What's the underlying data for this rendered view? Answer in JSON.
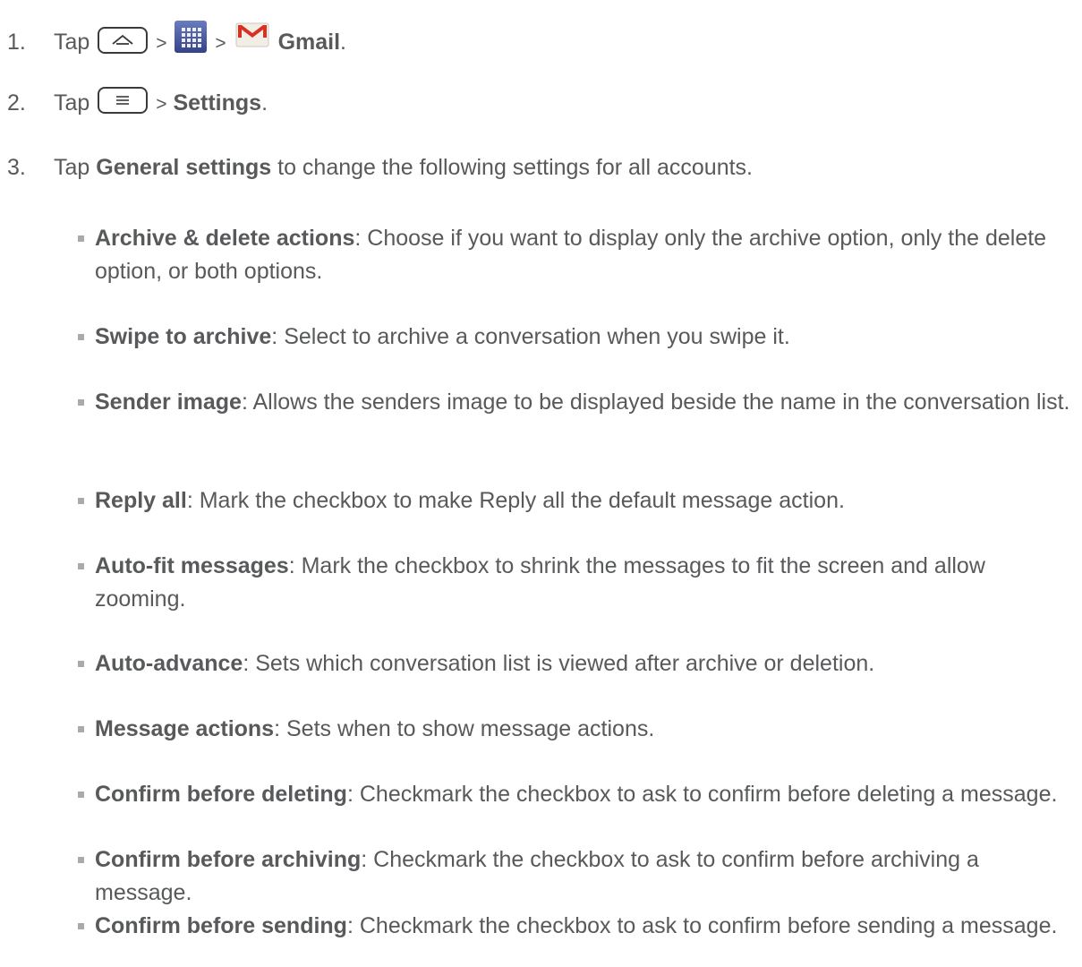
{
  "steps": [
    {
      "num": "1.",
      "pre": "Tap",
      "sep1": ">",
      "sep2": ">",
      "bold": "Gmail",
      "post": "."
    },
    {
      "num": "2.",
      "pre": "Tap",
      "sep1": ">",
      "bold": "Settings",
      "post": "."
    },
    {
      "num": "3.",
      "pre": "Tap ",
      "bold": "General settings",
      "post": " to change the following settings for all accounts."
    }
  ],
  "icons": {
    "home_key": "home-key-icon",
    "apps": "apps-grid-icon",
    "gmail": "gmail-envelope-icon",
    "menu_key": "menu-key-icon"
  },
  "bullets": [
    {
      "term": "Archive & delete actions",
      "desc": ": Choose if you want to display only the archive option, only the delete option, or both options."
    },
    {
      "term": "Swipe to archive",
      "desc": ": Select to archive a conversation when you swipe it."
    },
    {
      "term": "Sender image",
      "desc": ": Allows the senders image to be displayed beside the name in the conversation list."
    },
    {
      "term": "Reply all",
      "desc": ": Mark the checkbox to make Reply all the default message action."
    },
    {
      "term": "Auto-fit messages",
      "desc": ": Mark the checkbox to shrink the messages to fit the screen and allow zooming."
    },
    {
      "term": "Auto-advance",
      "desc": ": Sets which conversation list is viewed after archive or deletion."
    },
    {
      "term": "Message actions",
      "desc": ": Sets when to show message actions."
    },
    {
      "term": "Confirm before deleting",
      "desc": ": Checkmark the checkbox to ask to confirm before deleting a message."
    },
    {
      "term": "Confirm before archiving",
      "desc": ": Checkmark the checkbox to ask to confirm before archiving a message."
    },
    {
      "term": "Confirm before sending",
      "desc": ": Checkmark the checkbox to ask to confirm before sending a message."
    }
  ]
}
